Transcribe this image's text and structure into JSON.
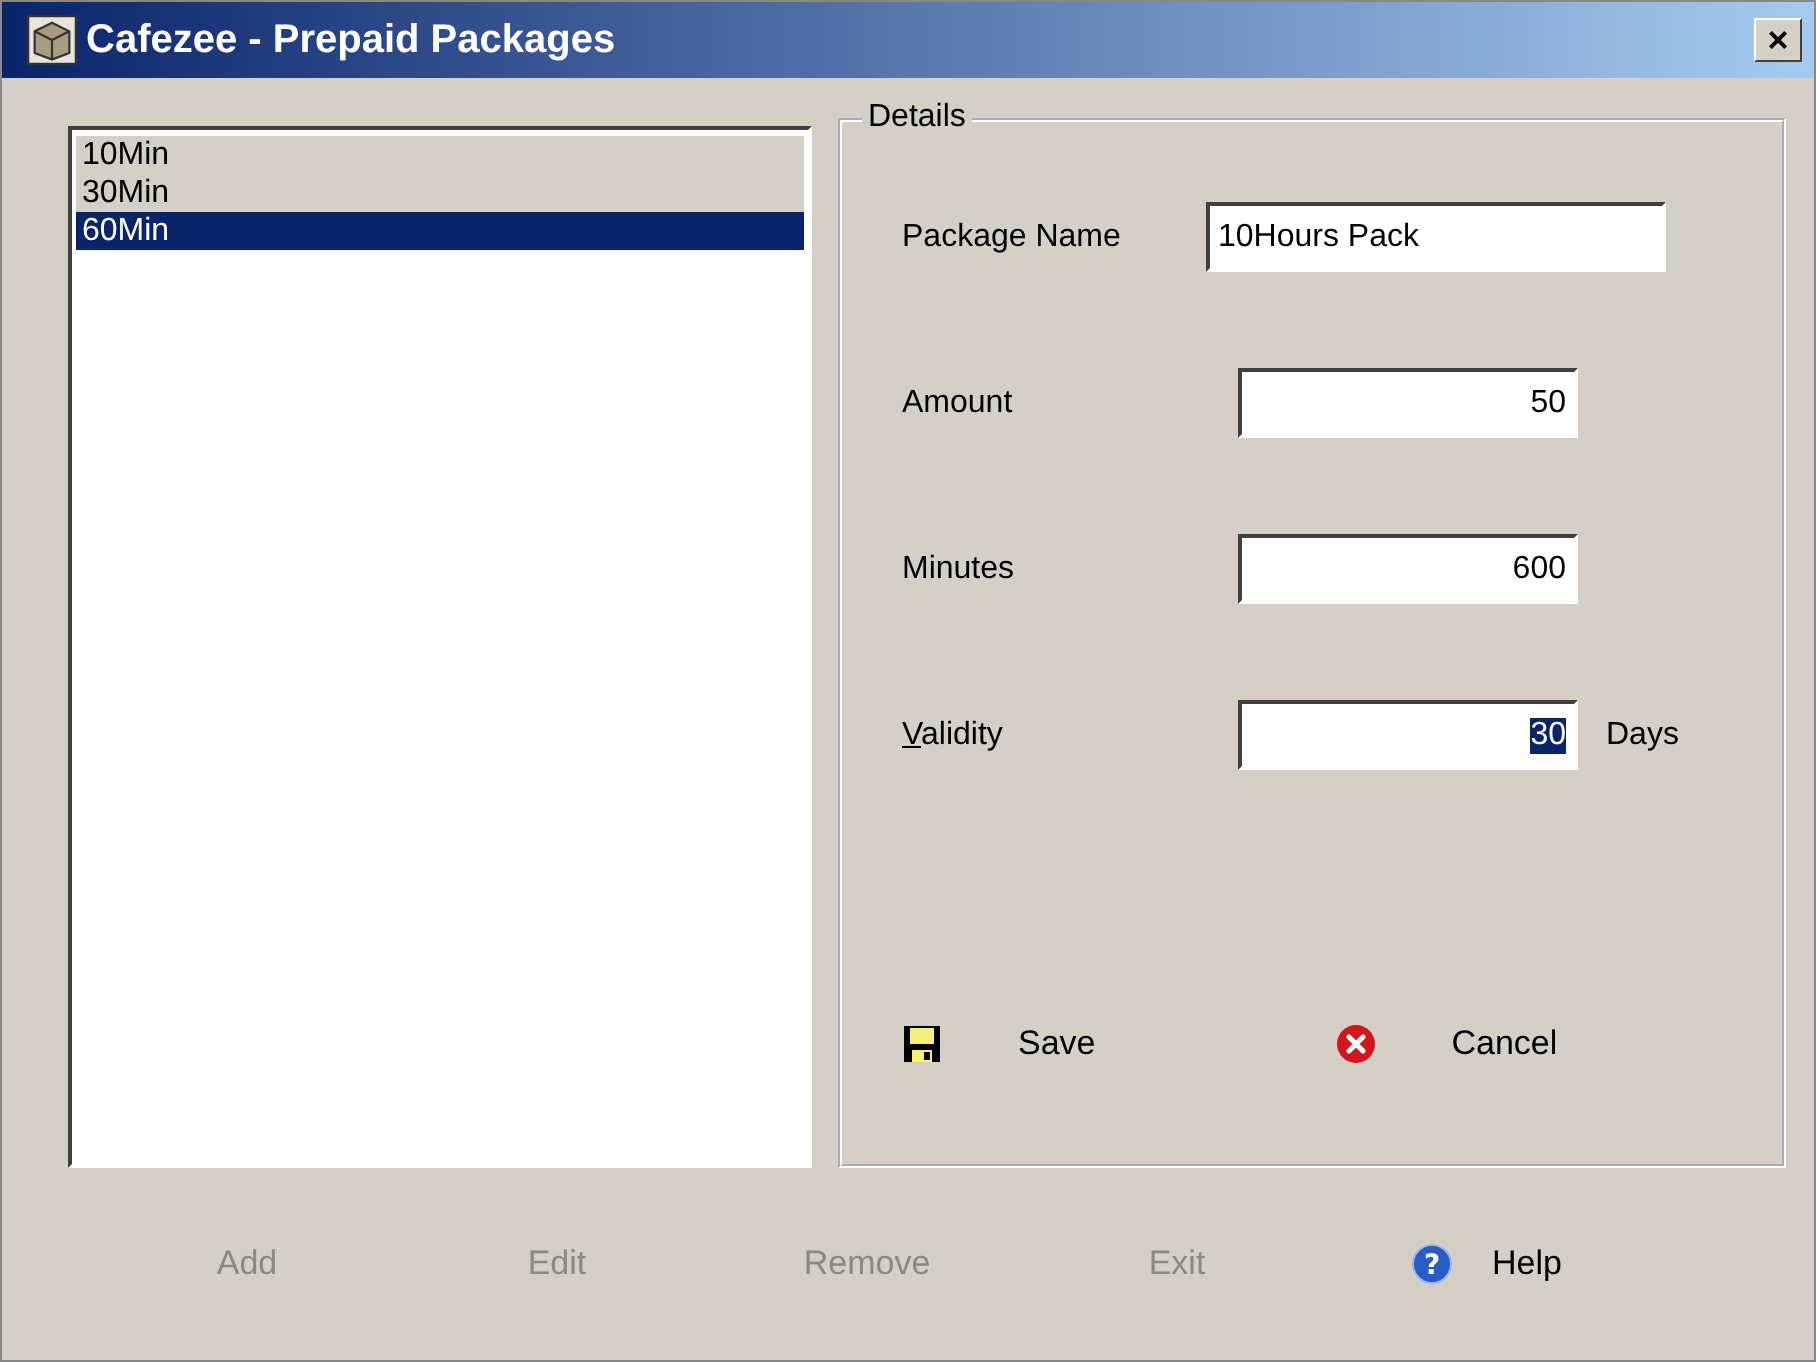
{
  "window": {
    "title": "Cafezee - Prepaid Packages",
    "close": "×"
  },
  "packages": [
    {
      "label": "10Min",
      "selected": false
    },
    {
      "label": "30Min",
      "selected": false
    },
    {
      "label": "60Min",
      "selected": true
    }
  ],
  "details": {
    "title": "Details",
    "fields": [
      {
        "label": "Package Name",
        "value": "10Hours Pack",
        "kind": "text",
        "mnemonic": false,
        "value_selected": false
      },
      {
        "label": "Amount",
        "value": "50",
        "kind": "number",
        "mnemonic": false,
        "value_selected": false
      },
      {
        "label": "Minutes",
        "value": "600",
        "kind": "number",
        "mnemonic": false,
        "value_selected": false
      },
      {
        "label": "Validity",
        "value": "30",
        "kind": "number",
        "mnemonic": true,
        "value_selected": true,
        "unit": "Days"
      }
    ],
    "actions": [
      {
        "label": "Save",
        "kind": "save"
      },
      {
        "label": "Cancel",
        "kind": "cancel"
      }
    ]
  },
  "buttons": [
    {
      "label": "Add",
      "disabled": true
    },
    {
      "label": "Edit",
      "disabled": true
    },
    {
      "label": "Remove",
      "disabled": true
    },
    {
      "label": "Exit",
      "disabled": true
    },
    {
      "label": "Help",
      "disabled": false,
      "kind": "help",
      "icon_text": "?"
    }
  ]
}
